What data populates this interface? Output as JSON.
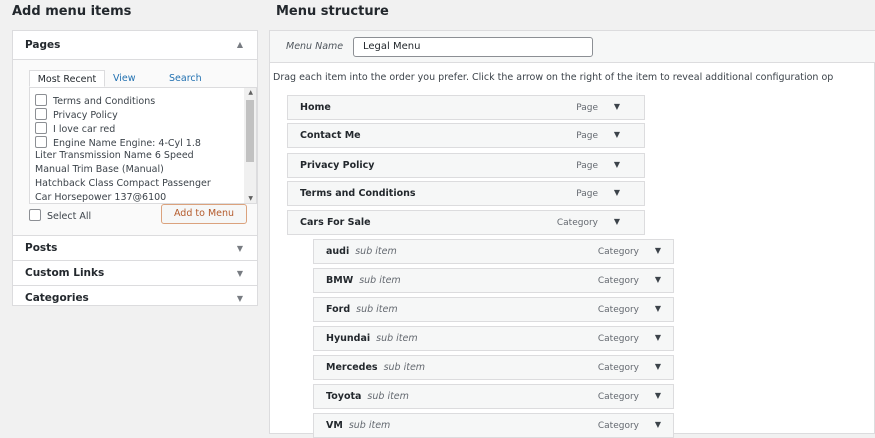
{
  "left": {
    "title": "Add menu items",
    "pages": {
      "label": "Pages",
      "tabs": [
        "Most Recent",
        "View All",
        "Search"
      ],
      "items": [
        {
          "label": "Terms and Conditions",
          "checkbox": true
        },
        {
          "label": "Privacy Policy",
          "checkbox": true
        },
        {
          "label": "I love car red",
          "checkbox": true
        },
        {
          "label": "Engine Name Engine: 4-Cyl 1.8",
          "checkbox": true
        },
        {
          "label": "Liter Transmission Name 6 Speed",
          "checkbox": false
        },
        {
          "label": "Manual Trim Base (Manual)",
          "checkbox": false
        },
        {
          "label": "Hatchback Class Compact Passenger",
          "checkbox": false
        },
        {
          "label": "Car Horsepower 137@6100",
          "checkbox": false
        }
      ],
      "select_all": "Select All",
      "add_button": "Add to Menu"
    },
    "sections": [
      "Posts",
      "Custom Links",
      "Categories"
    ]
  },
  "right": {
    "title": "Menu structure",
    "menu_name_label": "Menu Name",
    "menu_name_value": "Legal Menu",
    "instructions": "Drag each item into the order you prefer. Click the arrow on the right of the item to reveal additional configuration op",
    "items": [
      {
        "title": "Home",
        "type": "Page"
      },
      {
        "title": "Contact Me",
        "type": "Page"
      },
      {
        "title": "Privacy Policy",
        "type": "Page"
      },
      {
        "title": "Terms and Conditions",
        "type": "Page"
      },
      {
        "title": "Cars For Sale",
        "type": "Category"
      }
    ],
    "sub_item_label": "sub item",
    "sub_items": [
      {
        "title": "audi",
        "type": "Category"
      },
      {
        "title": "BMW",
        "type": "Category"
      },
      {
        "title": "Ford",
        "type": "Category"
      },
      {
        "title": "Hyundai",
        "type": "Category"
      },
      {
        "title": "Mercedes",
        "type": "Category"
      },
      {
        "title": "Toyota",
        "type": "Category"
      },
      {
        "title": "VM",
        "type": "Category"
      }
    ]
  },
  "colors": {
    "link": "#2271b1",
    "button_text": "#b45b2c",
    "border": "#dcdcde"
  },
  "icons": {
    "expand": "caret-down-icon",
    "collapse": "caret-up-icon"
  }
}
